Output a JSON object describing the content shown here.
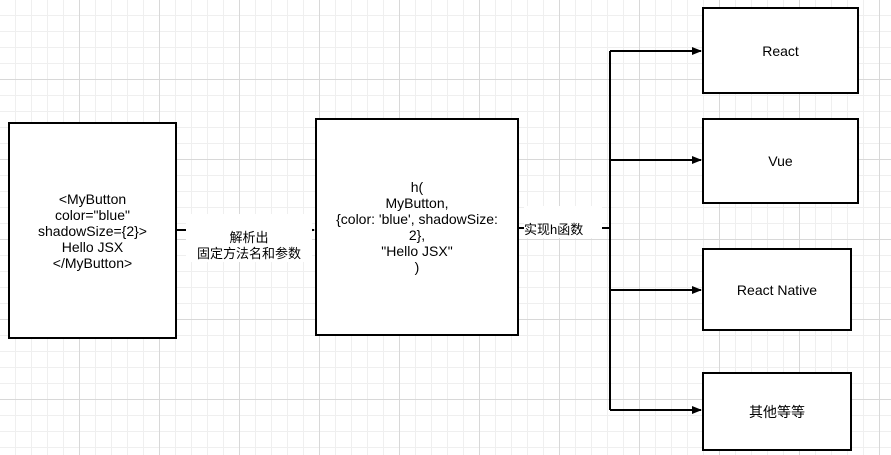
{
  "nodes": {
    "source": {
      "text": "<MyButton\ncolor=\"blue\"\nshadowSize={2}>\nHello JSX\n</MyButton>"
    },
    "hcall": {
      "text": "h(\nMyButton,\n{color: 'blue', shadowSize:\n2},\n\"Hello JSX\"\n)"
    },
    "react": {
      "text": "React"
    },
    "vue": {
      "text": "Vue"
    },
    "react_native": {
      "text": "React Native"
    },
    "others": {
      "text": "其他等等"
    }
  },
  "edges": {
    "parse": {
      "label": "解析出\n固定方法名和参数"
    },
    "implement": {
      "label": "实现h函数"
    }
  }
}
